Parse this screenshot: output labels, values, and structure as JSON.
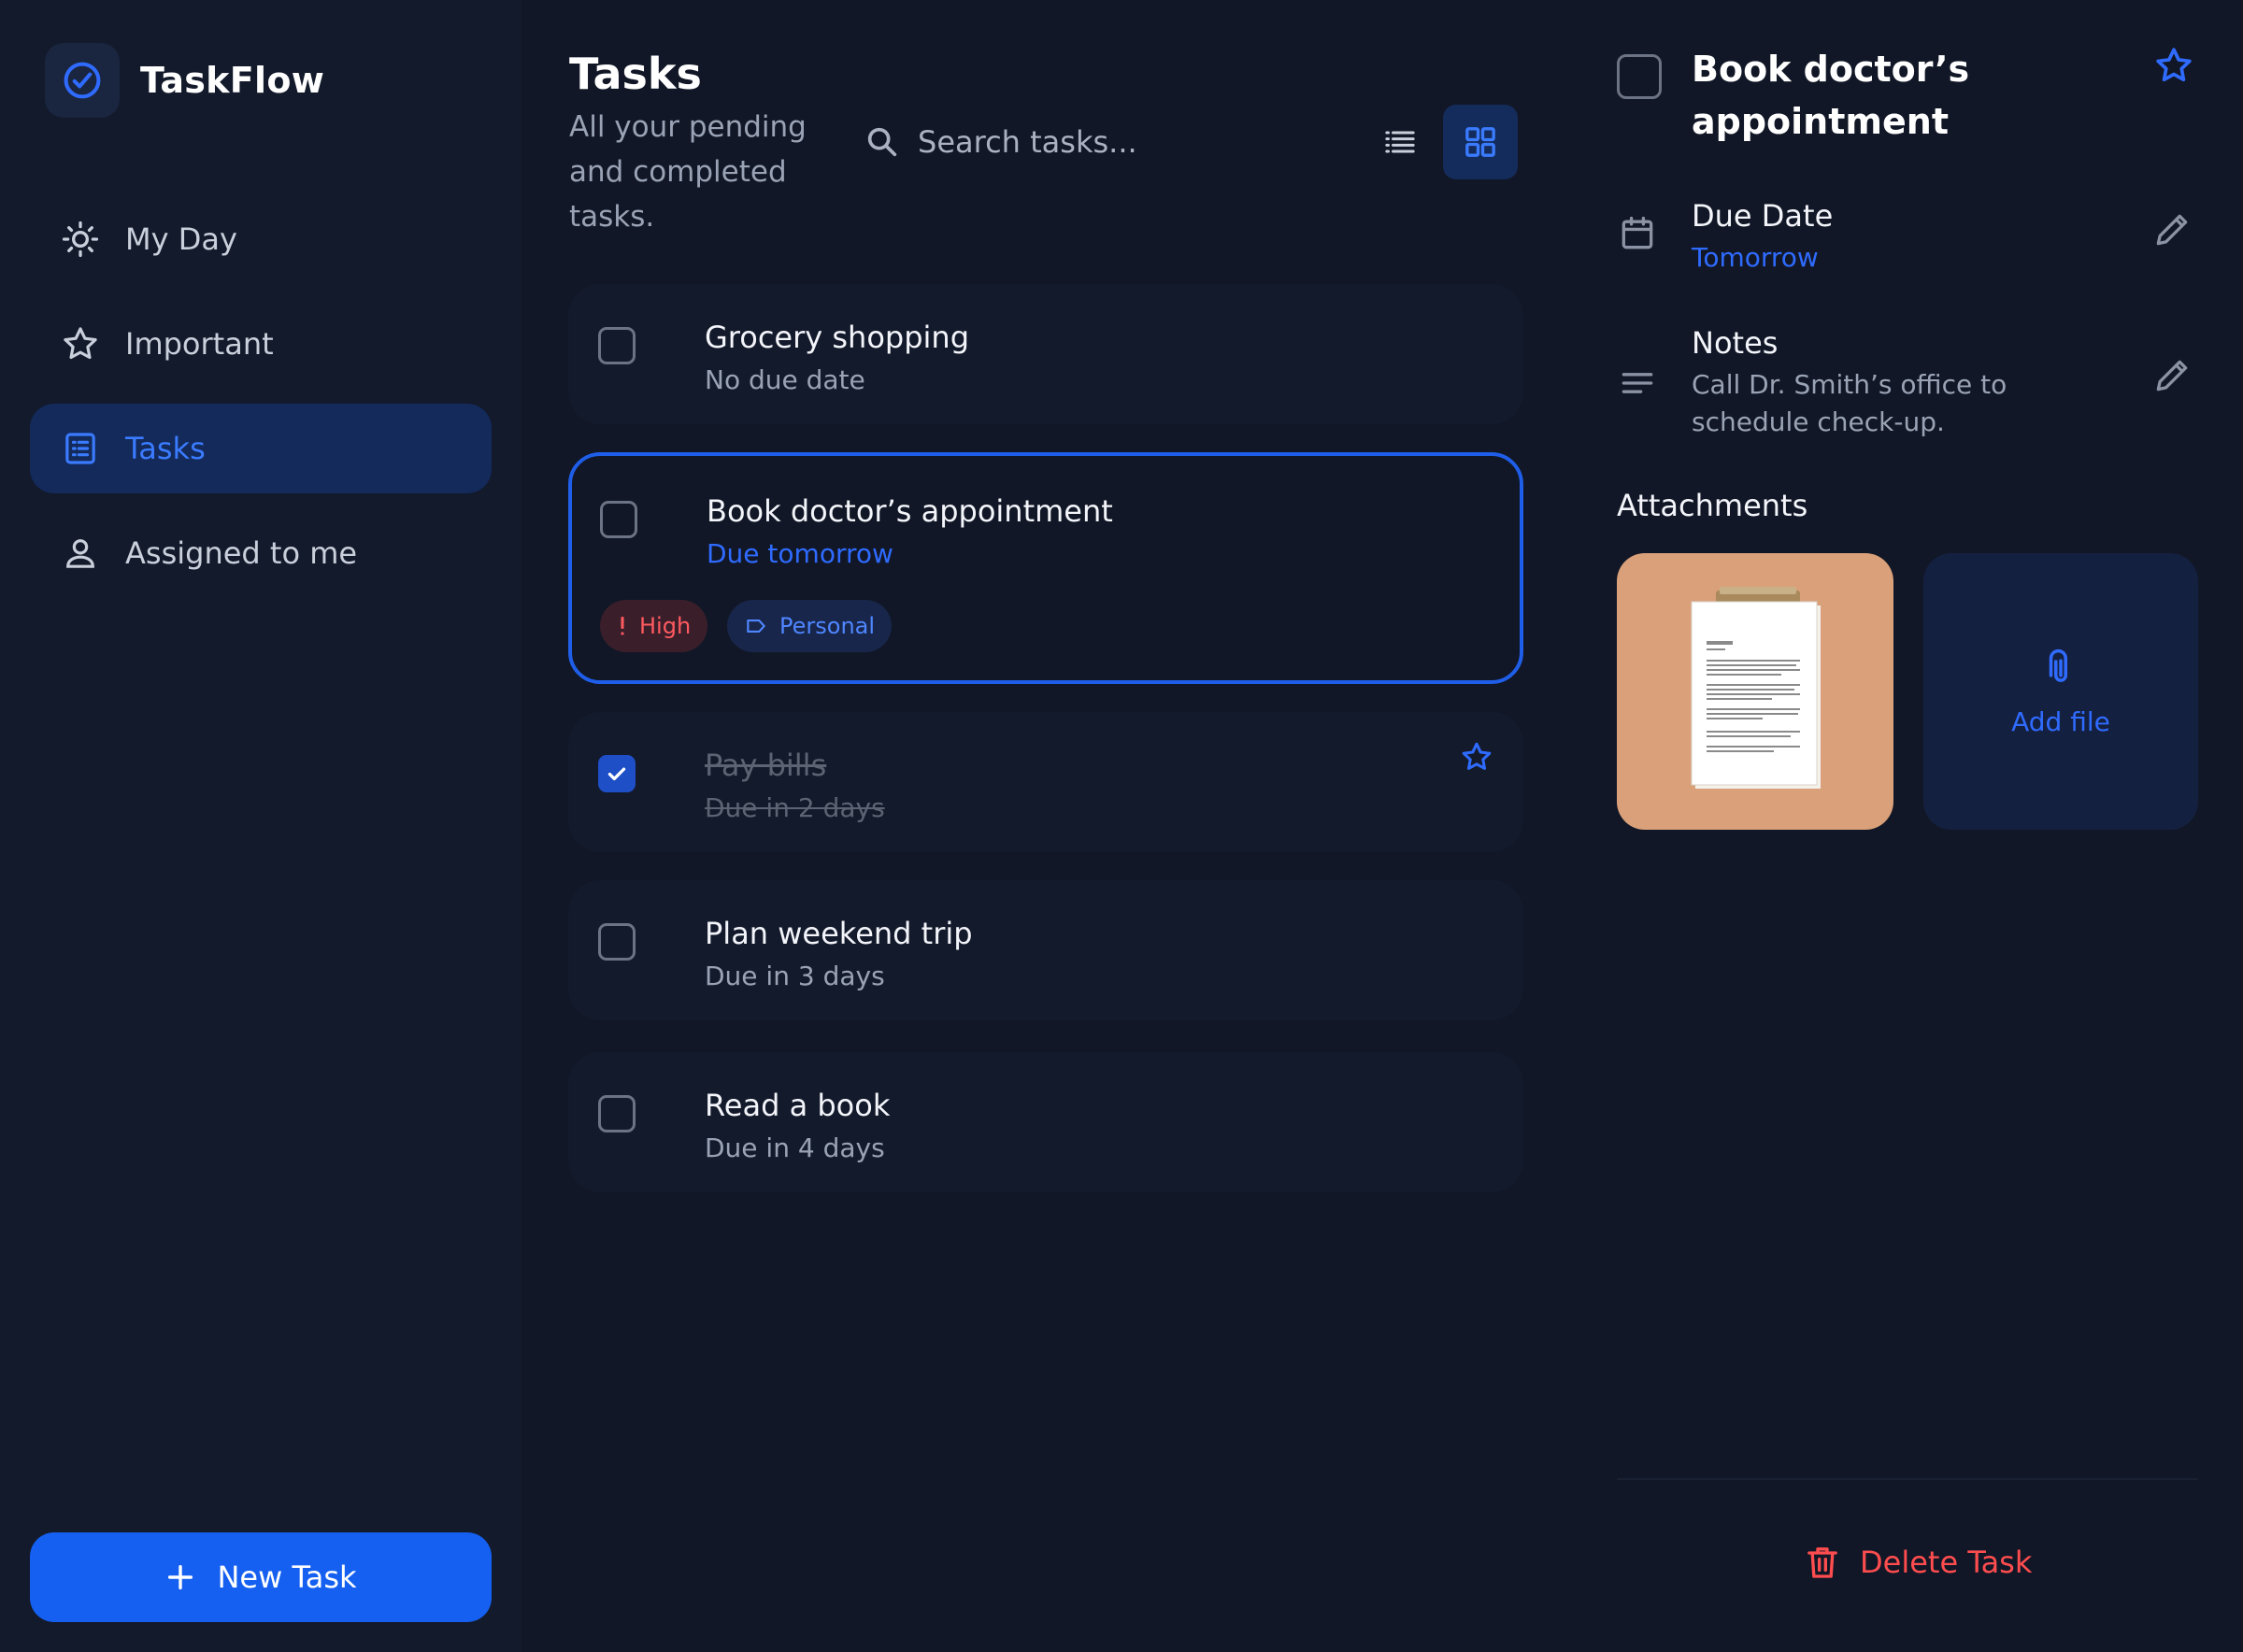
{
  "app": {
    "name": "TaskFlow"
  },
  "sidebar": {
    "items": [
      {
        "label": "My Day",
        "icon": "sun-icon",
        "active": false
      },
      {
        "label": "Important",
        "icon": "star-icon",
        "active": false
      },
      {
        "label": "Tasks",
        "icon": "list-icon",
        "active": true
      },
      {
        "label": "Assigned to me",
        "icon": "person-icon",
        "active": false
      }
    ],
    "new_task_label": "New Task"
  },
  "main": {
    "title": "Tasks",
    "subtitle": "All your pending and completed tasks.",
    "search_placeholder": "Search tasks...",
    "tasks": [
      {
        "title": "Grocery shopping",
        "subtitle": "No due date",
        "completed": false,
        "selected": false
      },
      {
        "title": "Book doctor’s appointment",
        "subtitle": "Due tomorrow",
        "completed": false,
        "selected": true,
        "tags": [
          {
            "label": "High",
            "icon": "exclamation-icon"
          },
          {
            "label": "Personal",
            "icon": "tag-icon"
          }
        ]
      },
      {
        "title": "Pay bills",
        "subtitle": "Due in 2 days",
        "completed": true,
        "selected": false,
        "starred": true
      },
      {
        "title": "Plan weekend trip",
        "subtitle": "Due in 3 days",
        "completed": false,
        "selected": false
      },
      {
        "title": "Read a book",
        "subtitle": "Due in 4 days",
        "completed": false,
        "selected": false
      }
    ]
  },
  "detail": {
    "title": "Book doctor’s appointment",
    "due_label": "Due Date",
    "due_value": "Tomorrow",
    "notes_label": "Notes",
    "notes_value": "Call Dr. Smith’s office to schedule check-up.",
    "attachments_label": "Attachments",
    "add_file_label": "Add file",
    "delete_label": "Delete Task"
  },
  "colors": {
    "background": "#111726",
    "sidebar": "#131a2b",
    "accent": "#1560f0",
    "accent_text": "#2f6bff",
    "danger": "#ff4d4f",
    "attachment_bg": "#d9a07a"
  }
}
